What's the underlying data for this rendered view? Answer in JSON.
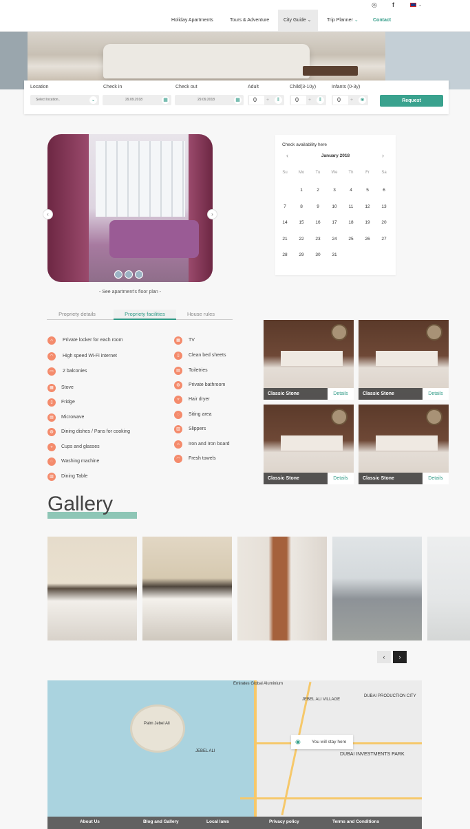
{
  "header": {
    "social": [
      "instagram-icon",
      "facebook-icon"
    ],
    "language_icon": "uk-flag-icon",
    "nav": [
      {
        "label": "Holiday Apartments"
      },
      {
        "label": "Tours & Adventure"
      },
      {
        "label": "City Guide"
      },
      {
        "label": "Trip Planner"
      },
      {
        "label": "Contact"
      }
    ]
  },
  "booking": {
    "location_label": "Location",
    "location_placeholder": "Select location..",
    "checkin_label": "Check in",
    "checkin_value": "29.09.2018",
    "checkout_label": "Check out",
    "checkout_value": "29.09.2018",
    "adult_label": "Adult",
    "adult_value": "0",
    "child_label": "Child(3-10y)",
    "child_value": "0",
    "infant_label": "Infants (0-3y)",
    "infant_value": "0",
    "plus": "+",
    "request_label": "Request"
  },
  "slider": {
    "floor_plan_text": "- See apartment's floor plan -"
  },
  "calendar": {
    "title": "Check availability here",
    "month": "January 2018",
    "weekdays": [
      "Su",
      "Mo",
      "Tu",
      "We",
      "Th",
      "Fr",
      "Sa"
    ],
    "days": [
      "1",
      "2",
      "3",
      "4",
      "5",
      "6",
      "7",
      "8",
      "9",
      "10",
      "11",
      "12",
      "13",
      "14",
      "15",
      "16",
      "17",
      "18",
      "19",
      "20",
      "21",
      "22",
      "23",
      "24",
      "25",
      "26",
      "27",
      "28",
      "29",
      "30",
      "31"
    ]
  },
  "tabs": [
    {
      "label": "Propriety details"
    },
    {
      "label": "Propriety facilities"
    },
    {
      "label": "House rules"
    }
  ],
  "facilities_left": [
    "Private locker for each room",
    "High speed Wi-Fi internet",
    "2 balconies",
    "Stove",
    "Fridge",
    "Microwave",
    "Dining dishes / Pans for cooking",
    "Cups and glasses",
    "Washing machine",
    "Dining Table"
  ],
  "facilities_right": [
    "TV",
    "Clean bed sheets",
    "Toiletries",
    "Private bathroom",
    "Hair dryer",
    "Siting area",
    "Slippers",
    "Iron and Iron board",
    "Fresh towels"
  ],
  "rooms": [
    {
      "name": "Classic Stone",
      "details": "Details"
    },
    {
      "name": "Classic Stone",
      "details": "Details"
    },
    {
      "name": "Classic Stone",
      "details": "Details"
    },
    {
      "name": "Classic Stone",
      "details": "Details"
    }
  ],
  "gallery": {
    "title": "Gallery"
  },
  "map": {
    "stay_text": "You will stay here",
    "labels": [
      "Emirates Global Aluminium",
      "Palm Jebel Ali",
      "JEBEL ALI VILLAGE",
      "DUBAI PRODUCTION CITY",
      "DUBAI INVESTMENTS PARK",
      "JEBEL ALI"
    ]
  },
  "footer": {
    "links": [
      "About Us",
      "Blog and Gallery",
      "Local laws",
      "Privacy policy",
      "Terms and Conditions"
    ]
  }
}
